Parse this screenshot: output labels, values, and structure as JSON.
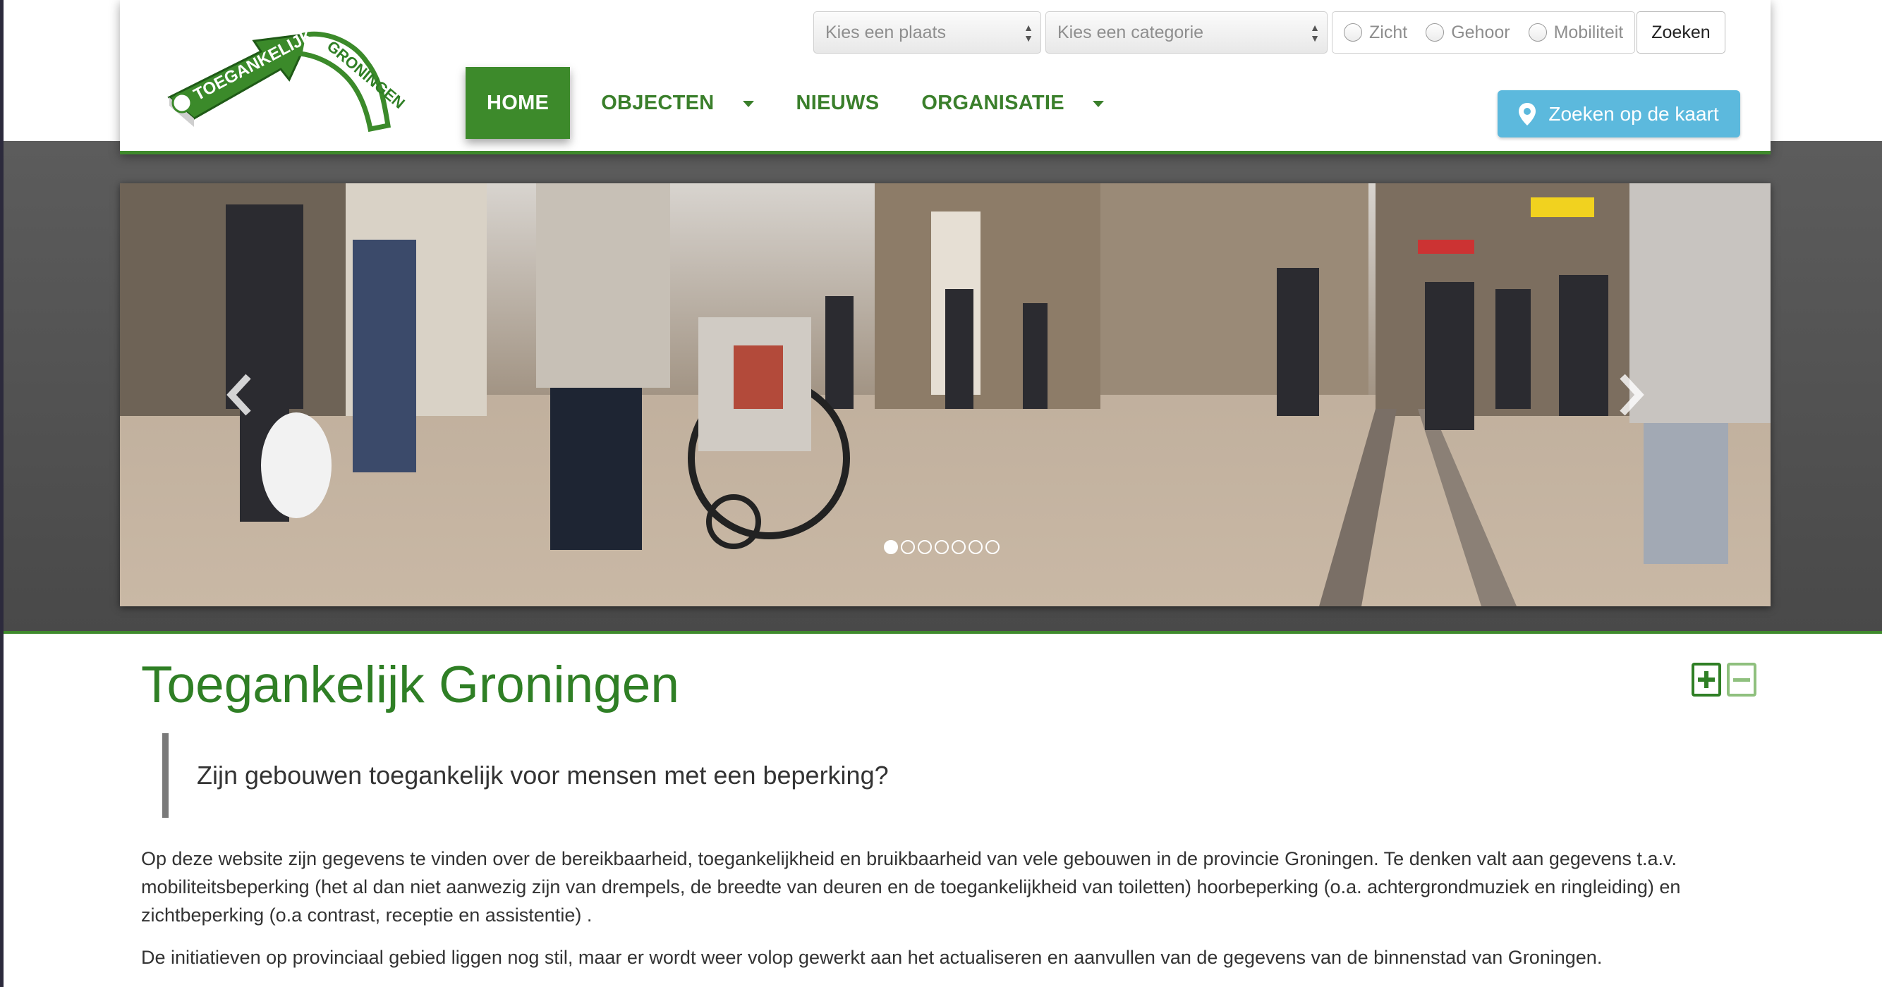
{
  "header": {
    "logo": {
      "line1": "TOEGANKELIJK",
      "line2": "GRONINGEN"
    },
    "nav": [
      {
        "label": "HOME",
        "active": true,
        "dropdown": false
      },
      {
        "label": "OBJECTEN",
        "active": false,
        "dropdown": true
      },
      {
        "label": "NIEUWS",
        "active": false,
        "dropdown": false
      },
      {
        "label": "ORGANISATIE",
        "active": false,
        "dropdown": true
      }
    ],
    "search": {
      "place_placeholder": "Kies een plaats",
      "category_placeholder": "Kies een categorie",
      "filters": [
        "Zicht",
        "Gehoor",
        "Mobiliteit"
      ],
      "button": "Zoeken"
    },
    "map_button": "Zoeken op de kaart"
  },
  "carousel": {
    "slide_count": 7,
    "active_index": 0
  },
  "main": {
    "title": "Toegankelijk Groningen",
    "lead": "Zijn gebouwen toegankelijk voor mensen met een beperking?",
    "paragraphs": [
      {
        "lines": [
          "Op deze website zijn gegevens te vinden over de bereikbaarheid, toegankelijkheid en bruikbaarheid van vele gebouwen in de provincie Groningen. Te denken valt aan gegevens t.a.v.",
          "mobiliteitsbeperking (het al dan niet aanwezig zijn van drempels, de breedte van deuren en de toegankelijkheid van toiletten) hoorbeperking (o.a. achtergrondmuziek en ringleiding) en",
          "zichtbeperking (o.a contrast, receptie en assistentie) ."
        ]
      },
      {
        "lines": [
          "De initiatieven op provinciaal gebied liggen nog stil, maar er wordt weer volop gewerkt aan het actualiseren en aanvullen van de gegevens van de binnenstad van Groningen."
        ]
      }
    ]
  },
  "colors": {
    "brand_green": "#3d8a2b",
    "map_button": "#5cb9dd",
    "title_green": "#2f7f25"
  },
  "icons": [
    "map-marker-icon",
    "chevron-left-icon",
    "chevron-right-icon",
    "plus-icon",
    "minus-icon",
    "caret-down-icon"
  ]
}
